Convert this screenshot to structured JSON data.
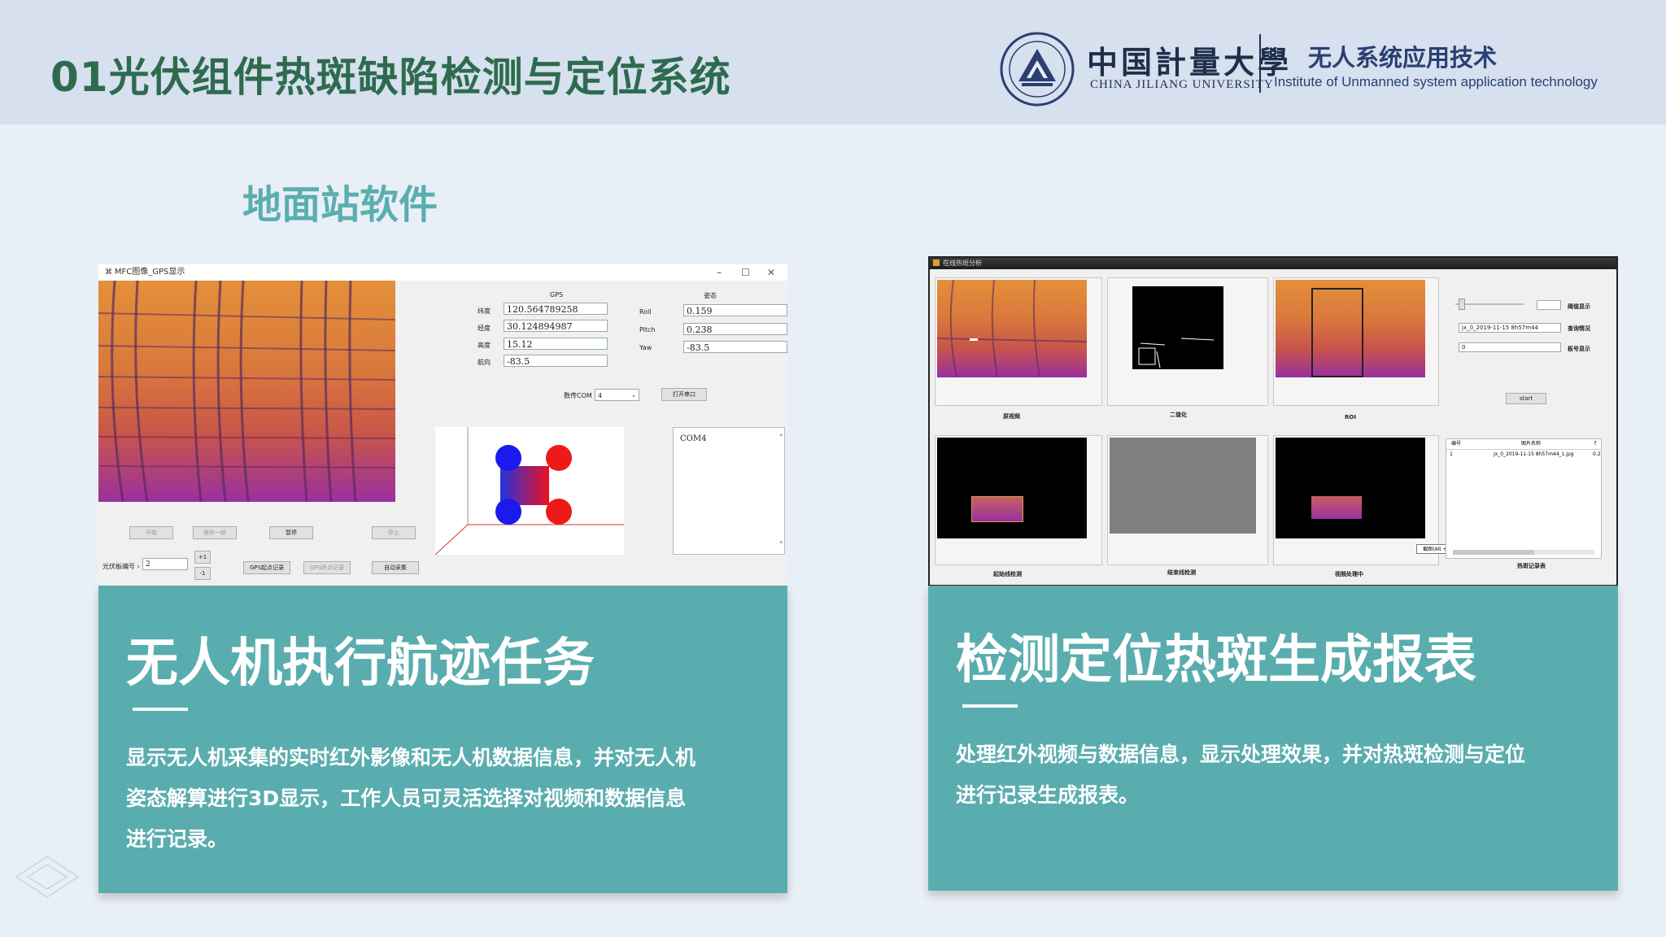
{
  "header": {
    "title": "01光伏组件热斑缺陷检测与定位系统",
    "university_cn": "中国計量大學",
    "university_en": "CHINA JILIANG UNIVERSITY",
    "institute_cn": "无人系统应用技术",
    "institute_en": "Institute of Unmanned system application technology"
  },
  "section_title": "地面站软件",
  "left_card": {
    "heading": "无人机执行航迹任务",
    "body_line1": "显示无人机采集的实时红外影像和无人机数据信息，并对无人机",
    "body_line2": "姿态解算进行3D显示，工作人员可灵活选择对视频和数据信息",
    "body_line3": "进行记录。"
  },
  "right_card": {
    "heading": "检测定位热斑生成报表",
    "body_line1": "处理红外视频与数据信息，显示处理效果，并对热斑检测与定位",
    "body_line2": "进行记录生成报表。"
  },
  "left_app": {
    "window_title": "MFC图像_GPS显示",
    "gps_label": "GPS",
    "attitude_label": "姿态",
    "lat_label": "纬度",
    "lat_value": "120.564789258",
    "lon_label": "经度",
    "lon_value": "30.124894987",
    "alt_label": "高度",
    "alt_value": "15.12",
    "heading_label": "航向",
    "heading_value": "-83.5",
    "roll_label": "Roll",
    "roll_value": "0.159",
    "pitch_label": "Pitch",
    "pitch_value": "0.238",
    "yaw_label": "Yaw",
    "yaw_value": "-83.5",
    "com_label": "数传COM",
    "com_value": "4",
    "open_port": "打开串口",
    "com_log": "COM4",
    "btn_start": "开始",
    "btn_save_frame": "保存一帧",
    "btn_pause": "暂停",
    "btn_stop": "停止",
    "panel_label": "光伏板编号",
    "panel_value": "2",
    "btn_plus": "+1",
    "btn_minus": "-1",
    "btn_gps_start": "GPS起点记录",
    "btn_gps_end": "GPS终点记录",
    "btn_auto": "自动采集"
  },
  "right_app": {
    "window_title": "在线热斑分析",
    "cap_original": "原视频",
    "cap_binary": "二值化",
    "cap_roi": "ROI",
    "cap_start_line": "起始线检测",
    "cap_end_line": "结束线检测",
    "cap_processing": "视频处理中",
    "label_threshold": "阈值显示",
    "label_query": "查询情况",
    "label_panel_no": "板号显示",
    "query_value": "jx_0_2019-11-15 8h57m44",
    "panel_no_value": "0",
    "btn_start": "start",
    "col_no": "编号",
    "col_name": "图片名称",
    "col_extra": "f",
    "row_no": "1",
    "row_name": "jx_0_2019-11-15 8h57m44_1.jpg",
    "row_extra": "0.2",
    "tooltip": "截图(Alt + Z)",
    "cap_record": "热斑记录表"
  },
  "colors": {
    "header_bg": "#d6e0ee",
    "title_green": "#2e6b4e",
    "accent_teal": "#5aadae",
    "page_bg": "#e9eff6"
  }
}
